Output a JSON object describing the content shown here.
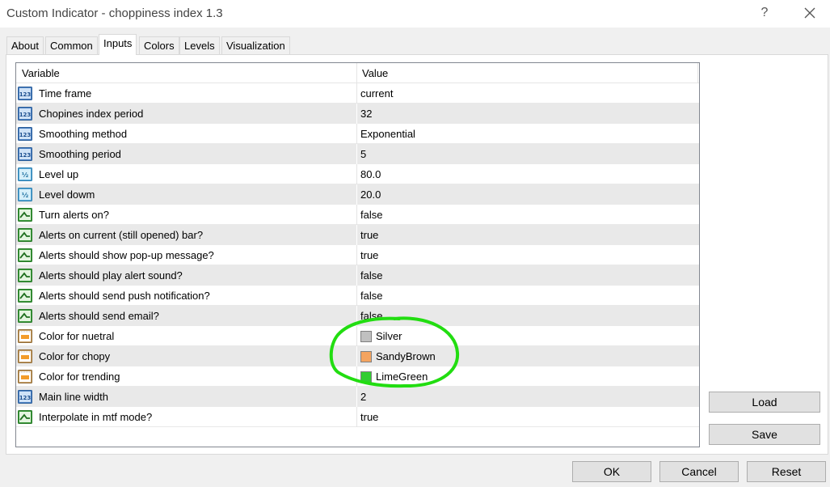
{
  "window": {
    "title": "Custom Indicator - choppiness index 1.3",
    "help_label": "?"
  },
  "tabs": [
    {
      "label": "About",
      "active": false
    },
    {
      "label": "Common",
      "active": false
    },
    {
      "label": "Inputs",
      "active": true
    },
    {
      "label": "Colors",
      "active": false
    },
    {
      "label": "Levels",
      "active": false
    },
    {
      "label": "Visualization",
      "active": false
    }
  ],
  "grid": {
    "headers": {
      "variable": "Variable",
      "value": "Value"
    },
    "rows": [
      {
        "name": "Time frame",
        "value": "current",
        "icon": "integer-icon"
      },
      {
        "name": "Chopines index period",
        "value": "32",
        "icon": "integer-icon"
      },
      {
        "name": "Smoothing method",
        "value": "Exponential",
        "icon": "integer-icon"
      },
      {
        "name": "Smoothing period",
        "value": "5",
        "icon": "integer-icon"
      },
      {
        "name": "Level up",
        "value": "80.0",
        "icon": "fraction-icon"
      },
      {
        "name": "Level dowm",
        "value": "20.0",
        "icon": "fraction-icon"
      },
      {
        "name": "Turn alerts on?",
        "value": "false",
        "icon": "boolean-icon"
      },
      {
        "name": "Alerts on current (still opened) bar?",
        "value": "true",
        "icon": "boolean-icon"
      },
      {
        "name": "Alerts should show pop-up message?",
        "value": "true",
        "icon": "boolean-icon"
      },
      {
        "name": "Alerts should play alert sound?",
        "value": "false",
        "icon": "boolean-icon"
      },
      {
        "name": "Alerts should send push notification?",
        "value": "false",
        "icon": "boolean-icon"
      },
      {
        "name": "Alerts should send email?",
        "value": "false",
        "icon": "boolean-icon"
      },
      {
        "name": "Color for nuetral",
        "value": "Silver",
        "icon": "color-icon",
        "swatch": "#c0c0c0"
      },
      {
        "name": "Color for chopy",
        "value": "SandyBrown",
        "icon": "color-icon",
        "swatch": "#f4a460"
      },
      {
        "name": "Color for trending",
        "value": "LimeGreen",
        "icon": "color-icon",
        "swatch": "#32cd32"
      },
      {
        "name": "Main line width",
        "value": "2",
        "icon": "integer-icon"
      },
      {
        "name": "Interpolate in mtf mode?",
        "value": "true",
        "icon": "boolean-icon"
      }
    ]
  },
  "side_buttons": {
    "load": "Load",
    "save": "Save"
  },
  "footer_buttons": {
    "ok": "OK",
    "cancel": "Cancel",
    "reset": "Reset"
  },
  "colors": {
    "highlight_stroke": "#22dd11",
    "accent": "#0078d7"
  }
}
